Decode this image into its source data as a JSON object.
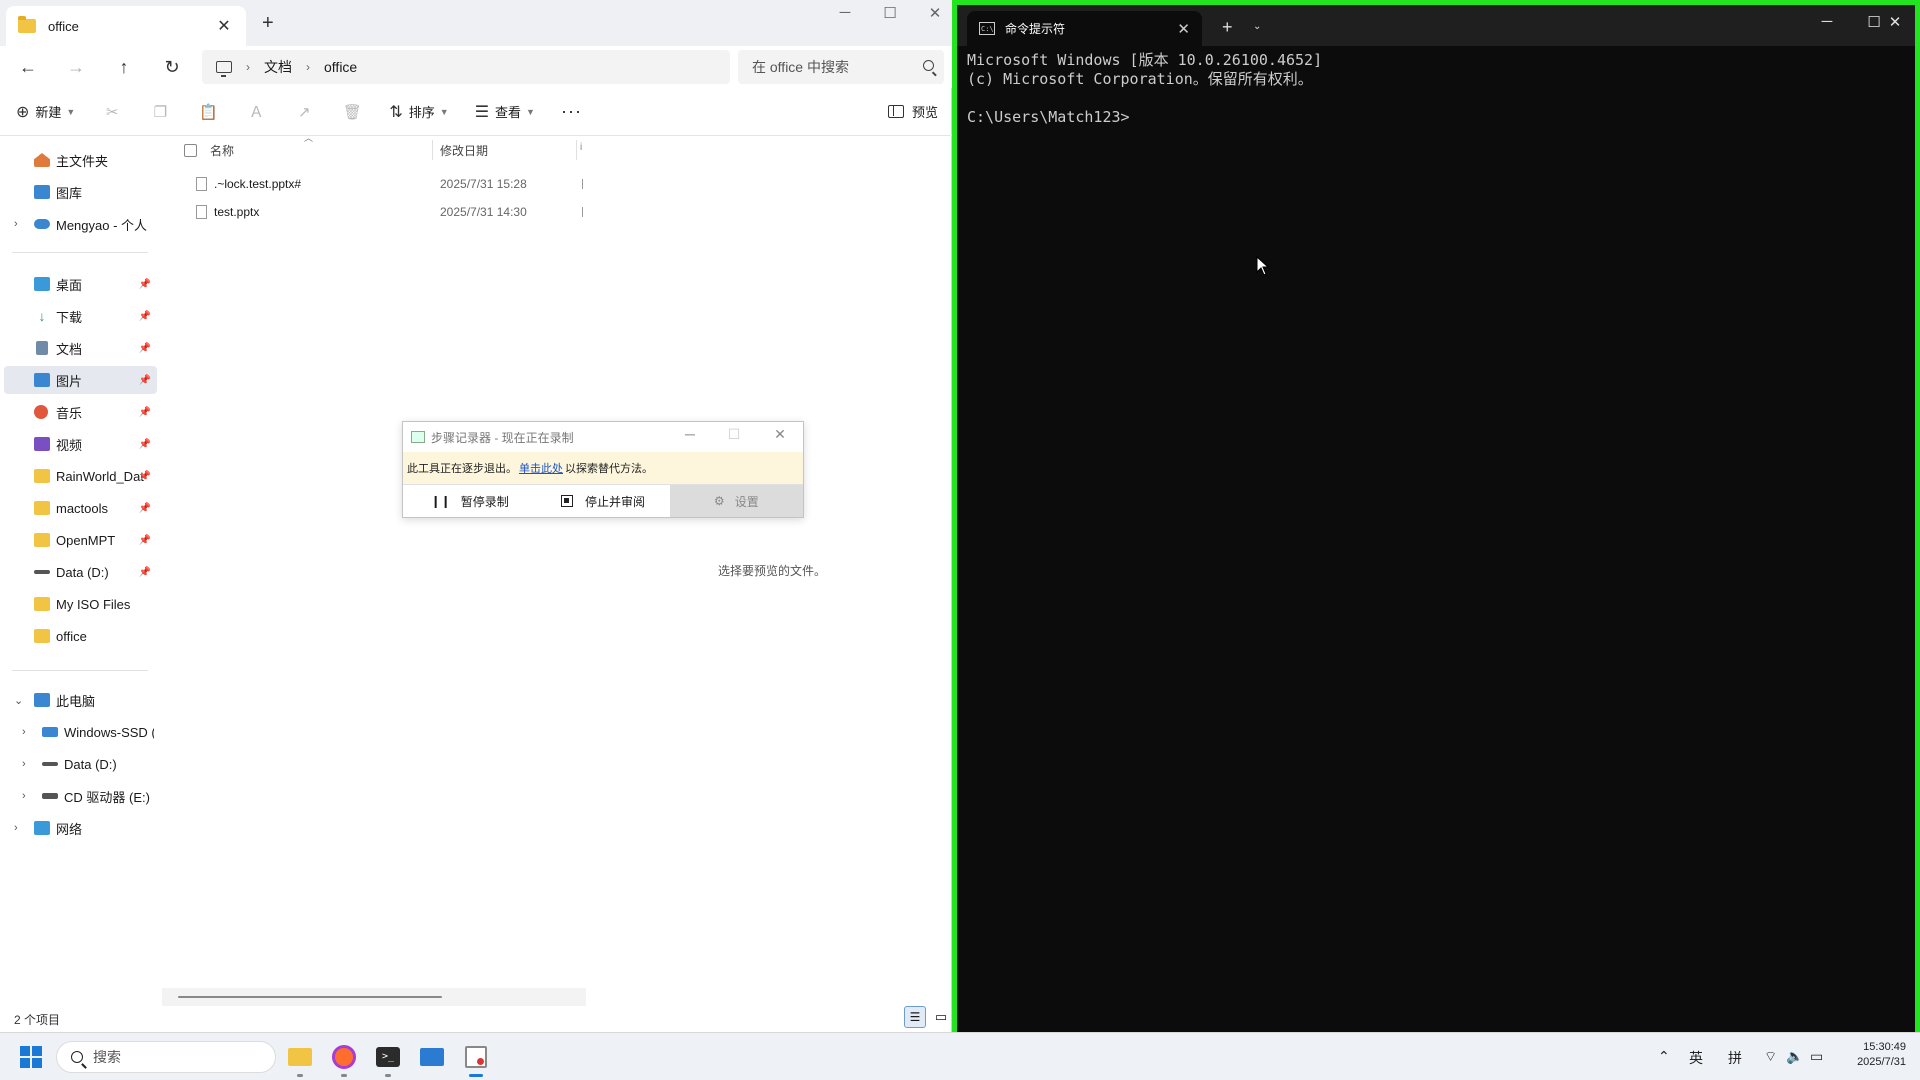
{
  "explorer": {
    "tab_title": "office",
    "breadcrumb": [
      "文档",
      "office"
    ],
    "search_placeholder": "在 office 中搜索",
    "commands": {
      "new": "新建",
      "sort": "排序",
      "view": "查看",
      "preview": "预览"
    },
    "sidebar": {
      "quick": [
        {
          "label": "主文件夹",
          "color": "#e07a3c"
        },
        {
          "label": "图库",
          "color": "#3a86d1"
        },
        {
          "label": "Mengyao - 个人",
          "color": "#3a86d1"
        }
      ],
      "pinned": [
        {
          "label": "桌面",
          "color": "#3a9ad9"
        },
        {
          "label": "下载",
          "color": "#2aa05a"
        },
        {
          "label": "文档",
          "color": "#6f8ba8"
        },
        {
          "label": "图片",
          "color": "#3a86d1"
        },
        {
          "label": "音乐",
          "color": "#e0573c"
        },
        {
          "label": "视频",
          "color": "#7a4fc2"
        },
        {
          "label": "RainWorld_Dat",
          "color": "#f2c443"
        },
        {
          "label": "mactools",
          "color": "#f2c443"
        },
        {
          "label": "OpenMPT",
          "color": "#f2c443"
        },
        {
          "label": "Data (D:)",
          "color": "#555555"
        },
        {
          "label": "My ISO Files",
          "color": "#f2c443"
        },
        {
          "label": "office",
          "color": "#f2c443"
        }
      ],
      "devices": [
        {
          "label": "此电脑",
          "color": "#3a86d1"
        },
        {
          "label": "Windows-SSD (C",
          "color": "#3a86d1"
        },
        {
          "label": "Data (D:)",
          "color": "#555555"
        },
        {
          "label": "CD 驱动器 (E:)",
          "color": "#555555"
        },
        {
          "label": "网络",
          "color": "#3a9ad9"
        }
      ]
    },
    "columns": {
      "name": "名称",
      "date": "修改日期"
    },
    "files": [
      {
        "name": ".~lock.test.pptx#",
        "date": "2025/7/31 15:28"
      },
      {
        "name": "test.pptx",
        "date": "2025/7/31 14:30"
      }
    ],
    "preview_empty": "选择要预览的文件。",
    "status": "2 个项目"
  },
  "recorder": {
    "title": "步骤记录器 - 现在正在录制",
    "warning_pre": "此工具正在逐步退出。",
    "warning_link": "单击此处",
    "warning_post": "以探索替代方法。",
    "pause": "暂停录制",
    "stop": "停止并审阅",
    "settings": "设置"
  },
  "terminal": {
    "tab_title": "命令提示符",
    "lines": [
      "Microsoft Windows [版本 10.0.26100.4652]",
      "(c) Microsoft Corporation。保留所有权利。",
      "",
      "C:\\Users\\Match123>"
    ]
  },
  "taskbar": {
    "search": "搜索",
    "ime_lang": "英",
    "ime_mode": "拼",
    "time": "15:30:49",
    "date": "2025/7/31"
  },
  "colors": {
    "accent": "#1a78d6",
    "terminal_border": "#22e51f",
    "terminal_bg": "#0c0c0c"
  }
}
